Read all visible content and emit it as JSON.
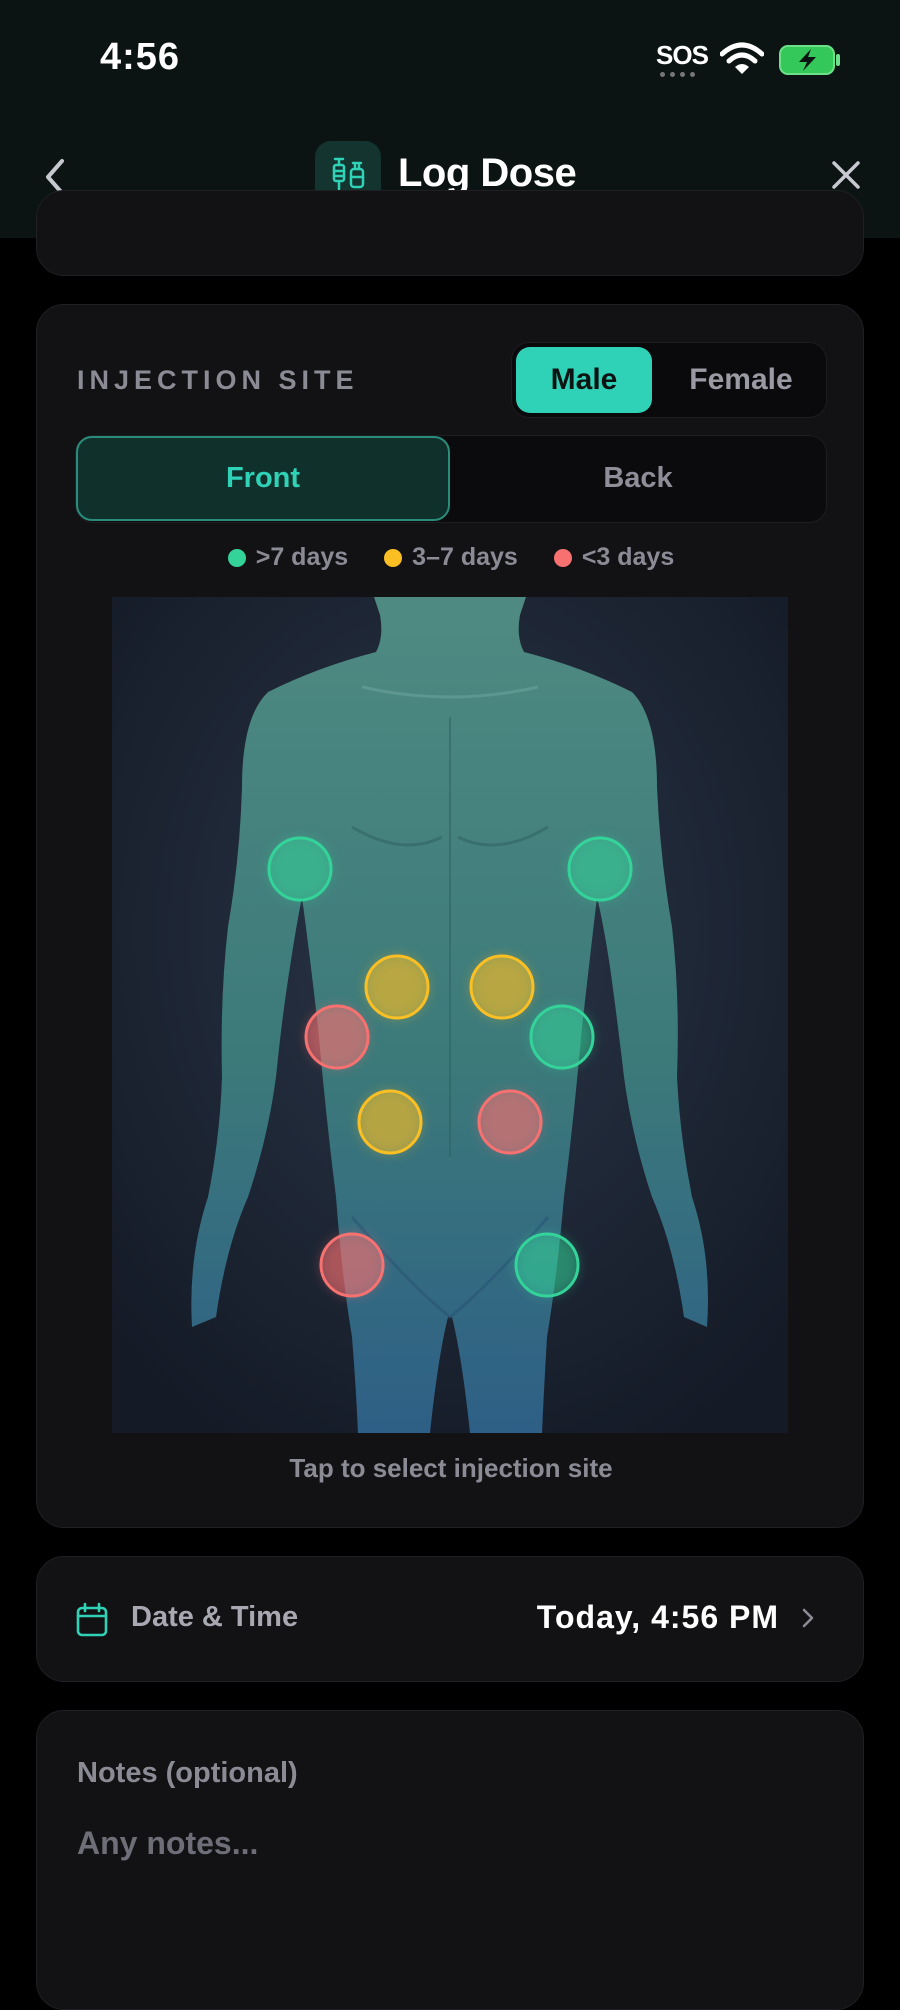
{
  "status_bar": {
    "time": "4:56",
    "sos": "SOS"
  },
  "nav": {
    "title": "Log Dose"
  },
  "injection": {
    "section_label": "INJECTION SITE",
    "gender": {
      "male": "Male",
      "female": "Female",
      "selected": "Male"
    },
    "view": {
      "front": "Front",
      "back": "Back",
      "selected": "Front"
    },
    "legend": [
      {
        "label": ">7 days",
        "color": "#34d399"
      },
      {
        "label": "3–7 days",
        "color": "#fbbf24"
      },
      {
        "label": "<3 days",
        "color": "#f87171"
      }
    ],
    "hint": "Tap to select injection site"
  },
  "date_time": {
    "label": "Date & Time",
    "value": "Today, 4:56 PM"
  },
  "notes": {
    "label": "Notes (optional)",
    "placeholder": "Any notes..."
  },
  "colors": {
    "accent": "#2fd2b6",
    "green": "#34d399",
    "yellow": "#fbbf24",
    "red": "#f87171"
  }
}
